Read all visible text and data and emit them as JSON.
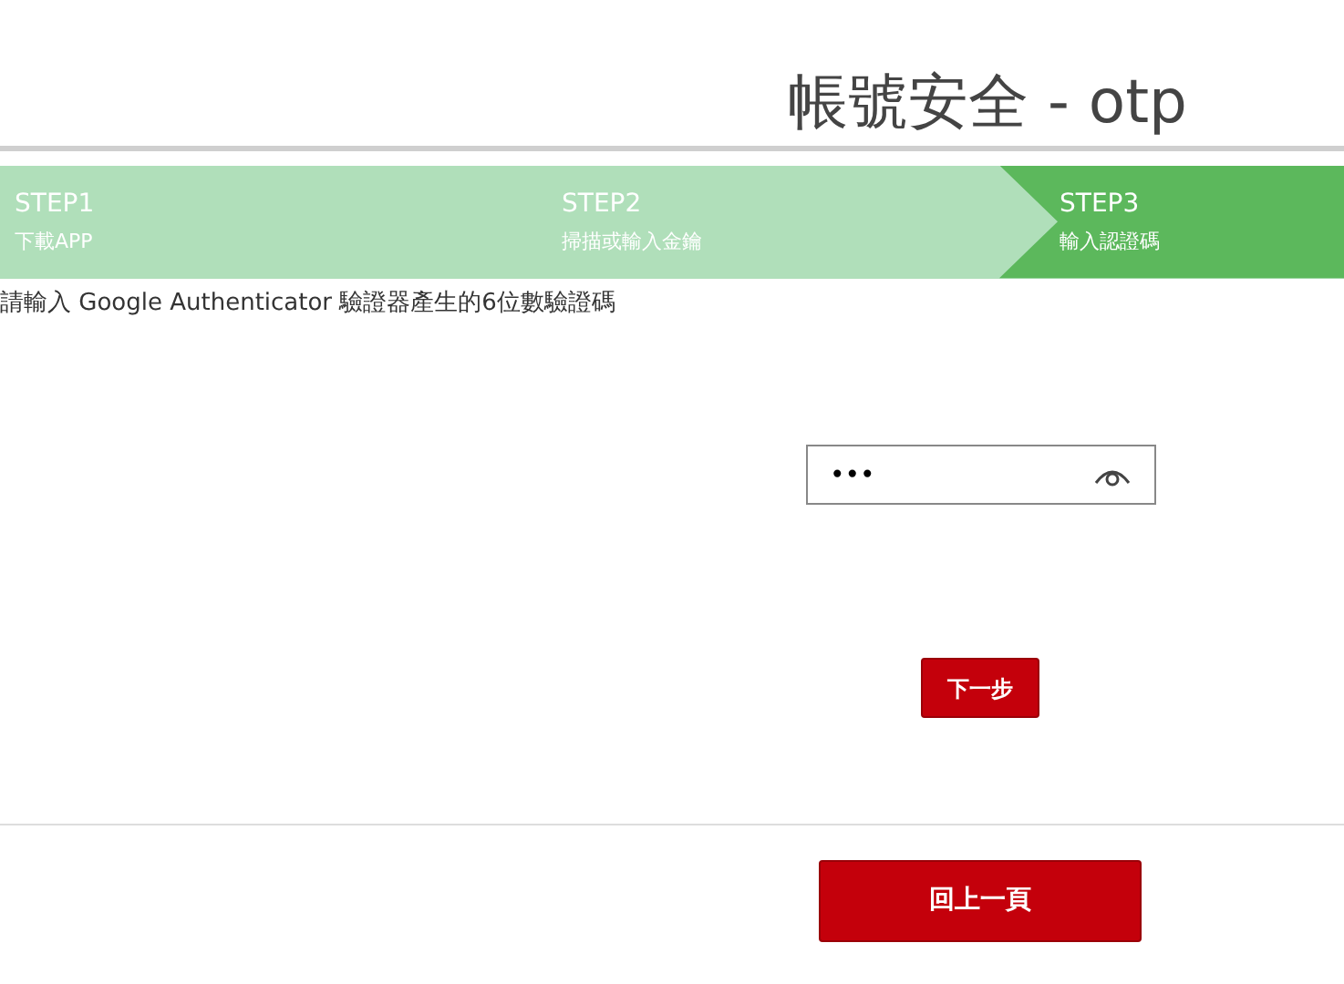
{
  "page_title": "帳號安全 - otp",
  "steps": [
    {
      "label": "STEP1",
      "caption": "下載APP",
      "selected": false
    },
    {
      "label": "STEP2",
      "caption": "掃描或輸入金鑰",
      "selected": false
    },
    {
      "label": "STEP3",
      "caption": "輸入認證碼",
      "selected": true
    }
  ],
  "instruction": "請輸入 Google Authenticator 驗證器產生的6位數驗證碼",
  "code_field": {
    "value": "•••"
  },
  "next_button": "下一步",
  "back_button": "回上一頁"
}
